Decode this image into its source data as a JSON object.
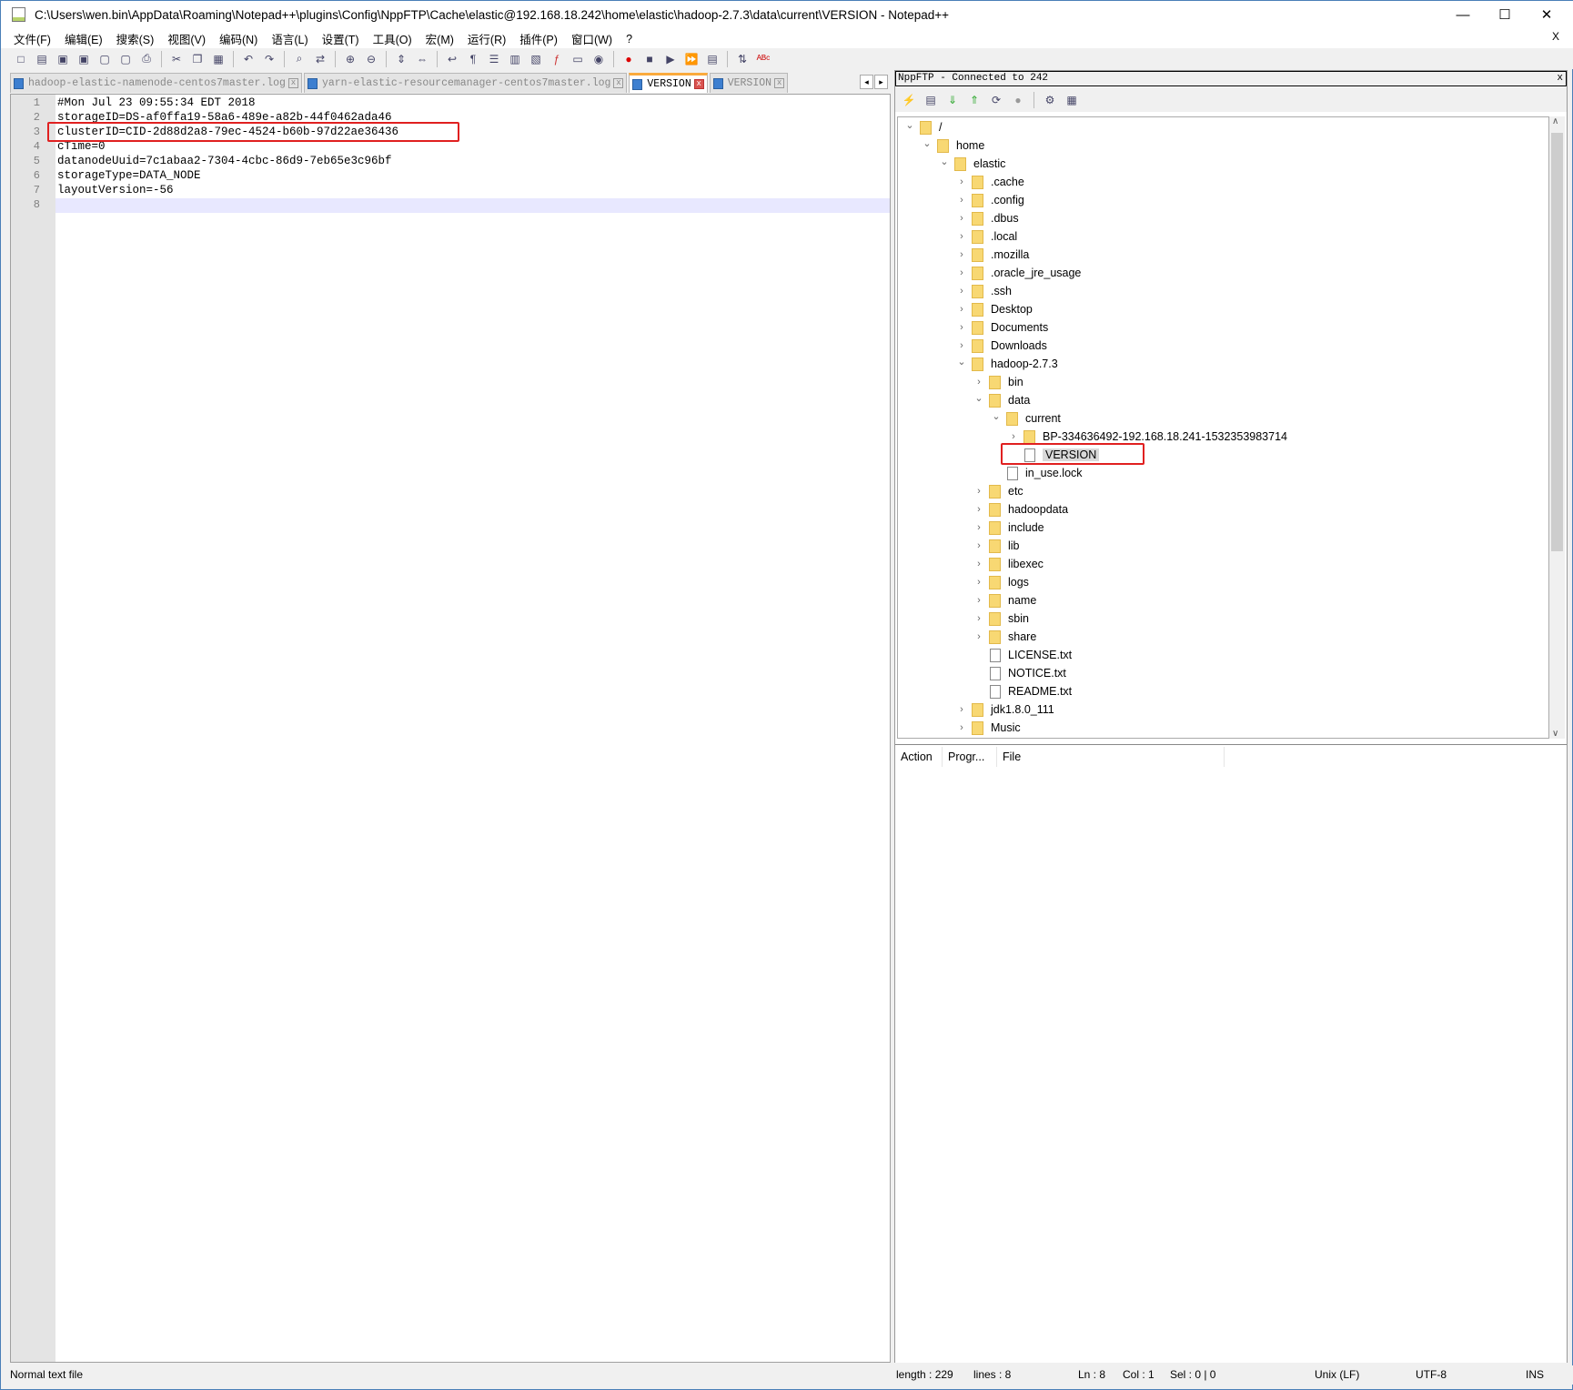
{
  "window": {
    "title": "C:\\Users\\wen.bin\\AppData\\Roaming\\Notepad++\\plugins\\Config\\NppFTP\\Cache\\elastic@192.168.18.242\\home\\elastic\\hadoop-2.7.3\\data\\current\\VERSION - Notepad++",
    "minimize": "—",
    "maximize": "☐",
    "close": "✕",
    "doc_close": "X"
  },
  "menu": [
    "文件(F)",
    "编辑(E)",
    "搜索(S)",
    "视图(V)",
    "编码(N)",
    "语言(L)",
    "设置(T)",
    "工具(O)",
    "宏(M)",
    "运行(R)",
    "插件(P)",
    "窗口(W)",
    "?"
  ],
  "toolbar": [
    "new-icon",
    "open-icon",
    "save-icon",
    "save-all-icon",
    "close-icon",
    "close-all-icon",
    "print-icon",
    "|",
    "cut-icon",
    "copy-icon",
    "paste-icon",
    "|",
    "undo-icon",
    "redo-icon",
    "|",
    "find-icon",
    "replace-icon",
    "|",
    "zoom-in-icon",
    "zoom-out-icon",
    "|",
    "sync-v-icon",
    "sync-h-icon",
    "|",
    "wrap-icon",
    "all-chars-icon",
    "indent-guide-icon",
    "udl-icon",
    "doc-map-icon",
    "function-list-icon",
    "folder-workspace-icon",
    "monitor-icon",
    "|",
    "record-macro-icon",
    "stop-macro-icon",
    "play-macro-icon",
    "run-macro-multiple-icon",
    "save-macro-icon",
    "|",
    "ftp-icon",
    "spellcheck-icon"
  ],
  "tabs": [
    {
      "label": "hadoop-elastic-namenode-centos7master.log",
      "active": false
    },
    {
      "label": "yarn-elastic-resourcemanager-centos7master.log",
      "active": false
    },
    {
      "label": "VERSION",
      "active": true
    },
    {
      "label": "VERSION",
      "active": false
    }
  ],
  "editor": {
    "lines": [
      "#Mon Jul 23 09:55:34 EDT 2018",
      "storageID=DS-af0ffa19-58a6-489e-a82b-44f0462ada46",
      "clusterID=CID-2d88d2a8-79ec-4524-b60b-97d22ae36436",
      "cTime=0",
      "datanodeUuid=7c1abaa2-7304-4cbc-86d9-7eb65e3c96bf",
      "storageType=DATA_NODE",
      "layoutVersion=-56",
      ""
    ],
    "current_line": 8,
    "highlighted_line": 3
  },
  "ftp": {
    "title": "NppFTP - Connected to 242",
    "close": "x",
    "toolbar": [
      "connect-icon",
      "open-dir-icon",
      "download-icon",
      "upload-icon",
      "refresh-icon",
      "abort-icon",
      "|",
      "settings-icon",
      "message-window-icon"
    ],
    "tree": [
      {
        "label": "/",
        "depth": 0,
        "type": "folder",
        "state": "open"
      },
      {
        "label": "home",
        "depth": 1,
        "type": "folder",
        "state": "open"
      },
      {
        "label": "elastic",
        "depth": 2,
        "type": "folder",
        "state": "open"
      },
      {
        "label": ".cache",
        "depth": 3,
        "type": "folder",
        "state": "closed"
      },
      {
        "label": ".config",
        "depth": 3,
        "type": "folder",
        "state": "closed"
      },
      {
        "label": ".dbus",
        "depth": 3,
        "type": "folder",
        "state": "closed"
      },
      {
        "label": ".local",
        "depth": 3,
        "type": "folder",
        "state": "closed"
      },
      {
        "label": ".mozilla",
        "depth": 3,
        "type": "folder",
        "state": "closed"
      },
      {
        "label": ".oracle_jre_usage",
        "depth": 3,
        "type": "folder",
        "state": "closed"
      },
      {
        "label": ".ssh",
        "depth": 3,
        "type": "folder",
        "state": "closed"
      },
      {
        "label": "Desktop",
        "depth": 3,
        "type": "folder",
        "state": "closed"
      },
      {
        "label": "Documents",
        "depth": 3,
        "type": "folder",
        "state": "closed"
      },
      {
        "label": "Downloads",
        "depth": 3,
        "type": "folder",
        "state": "closed"
      },
      {
        "label": "hadoop-2.7.3",
        "depth": 3,
        "type": "folder",
        "state": "open"
      },
      {
        "label": "bin",
        "depth": 4,
        "type": "folder",
        "state": "closed"
      },
      {
        "label": "data",
        "depth": 4,
        "type": "folder",
        "state": "open"
      },
      {
        "label": "current",
        "depth": 5,
        "type": "folder",
        "state": "open"
      },
      {
        "label": "BP-334636492-192.168.18.241-1532353983714",
        "depth": 6,
        "type": "folder",
        "state": "closed"
      },
      {
        "label": "VERSION",
        "depth": 6,
        "type": "file",
        "state": "none",
        "selected": true
      },
      {
        "label": "in_use.lock",
        "depth": 5,
        "type": "file",
        "state": "none"
      },
      {
        "label": "etc",
        "depth": 4,
        "type": "folder",
        "state": "closed"
      },
      {
        "label": "hadoopdata",
        "depth": 4,
        "type": "folder",
        "state": "closed"
      },
      {
        "label": "include",
        "depth": 4,
        "type": "folder",
        "state": "closed"
      },
      {
        "label": "lib",
        "depth": 4,
        "type": "folder",
        "state": "closed"
      },
      {
        "label": "libexec",
        "depth": 4,
        "type": "folder",
        "state": "closed"
      },
      {
        "label": "logs",
        "depth": 4,
        "type": "folder",
        "state": "closed"
      },
      {
        "label": "name",
        "depth": 4,
        "type": "folder",
        "state": "closed"
      },
      {
        "label": "sbin",
        "depth": 4,
        "type": "folder",
        "state": "closed"
      },
      {
        "label": "share",
        "depth": 4,
        "type": "folder",
        "state": "closed"
      },
      {
        "label": "LICENSE.txt",
        "depth": 4,
        "type": "file",
        "state": "none"
      },
      {
        "label": "NOTICE.txt",
        "depth": 4,
        "type": "file",
        "state": "none"
      },
      {
        "label": "README.txt",
        "depth": 4,
        "type": "file",
        "state": "none"
      },
      {
        "label": "jdk1.8.0_111",
        "depth": 3,
        "type": "folder",
        "state": "closed"
      },
      {
        "label": "Music",
        "depth": 3,
        "type": "folder",
        "state": "closed"
      }
    ],
    "queue_columns": [
      "Action",
      "Progr...",
      "File"
    ]
  },
  "status": {
    "type": "Normal text file",
    "length": "length : 229",
    "lines": "lines : 8",
    "ln": "Ln : 8",
    "col": "Col : 1",
    "sel": "Sel : 0 | 0",
    "eol": "Unix (LF)",
    "encoding": "UTF-8",
    "mode": "INS"
  },
  "colors": {
    "highlight_box": "#e02020",
    "active_tab_accent": "#faaa3c",
    "current_line": "#e8e8ff",
    "folder": "#f8d873"
  }
}
